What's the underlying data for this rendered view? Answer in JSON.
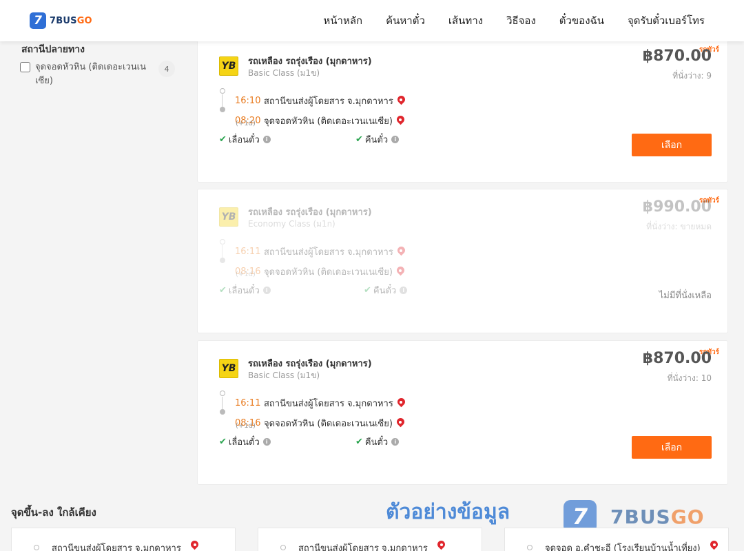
{
  "header": {
    "logo_text": "7BUS",
    "logo_text_go": "GO",
    "logo_mark": "7",
    "nav": [
      "หน้าหลัก",
      "ค้นหาตั๋ว",
      "เส้นทาง",
      "วิธีจอง",
      "ตั๋วของฉัน",
      "จุดรับตั๋วเบอร์โทร"
    ]
  },
  "filter": {
    "title": "สถานีปลายทาง",
    "items": [
      {
        "label": "จุดจอดหัวหิน (ติดเดอะเวนเนเซีย)",
        "count": "4"
      }
    ]
  },
  "trips": [
    {
      "tag": "รถทัวร์",
      "operator": "รถเหลือง รถรุ่งเรือง (มุกดาหาร)",
      "class": "Basic Class (ม1ข)",
      "price": "฿870.00",
      "seats": "ที่นั่งว่าง: 9",
      "depart_time": "16:10",
      "depart_place": "สถานีขนส่งผู้โดยสาร จ.มุกดาหาร",
      "arrive_time": "08:20",
      "arrive_place": "จุดจอดหัวหิน (ติดเดอะเวนเนเซีย)",
      "day_offset": "(+1d)",
      "feature1": "เลื่อนตั๋ว",
      "feature2": "คืนตั๋ว",
      "action": "เลือก"
    },
    {
      "tag": "รถทัวร์",
      "operator": "รถเหลือง รถรุ่งเรือง (มุกดาหาร)",
      "class": "Economy Class (ม1ก)",
      "price": "฿990.00",
      "seats": "ที่นั่งว่าง: ขายหมด",
      "depart_time": "16:11",
      "depart_place": "สถานีขนส่งผู้โดยสาร จ.มุกดาหาร",
      "arrive_time": "08:16",
      "arrive_place": "จุดจอดหัวหิน (ติดเดอะเวนเนเซีย)",
      "day_offset": "(+1d)",
      "feature1": "เลื่อนตั๋ว",
      "feature2": "คืนตั๋ว",
      "note": "ไม่มีที่นั่งเหลือ"
    },
    {
      "tag": "รถทัวร์",
      "operator": "รถเหลือง รถรุ่งเรือง (มุกดาหาร)",
      "class": "Basic Class (ม1ข)",
      "price": "฿870.00",
      "seats": "ที่นั่งว่าง: 10",
      "depart_time": "16:11",
      "depart_place": "สถานีขนส่งผู้โดยสาร จ.มุกดาหาร",
      "arrive_time": "08:16",
      "arrive_place": "จุดจอดหัวหิน (ติดเดอะเวนเนเซีย)",
      "day_offset": "(+1d)",
      "feature1": "เลื่อนตั๋ว",
      "feature2": "คืนตั๋ว",
      "action": "เลือก"
    }
  ],
  "nearby": {
    "title": "จุดขึ้น-ลง ใกล้เคียง",
    "items": [
      "สถานีขนส่งผู้โดยสาร จ.มุกดาหาร",
      "สถานีขนส่งผู้โดยสาร จ.มุกดาหาร",
      "จุดจอด อ.คำชะอี (โรงเรียนบ้านน้ำเที่ยง)"
    ]
  },
  "watermark": {
    "text": "ตัวอย่างข้อมูล",
    "logo_mark": "7",
    "logo_text": "7BUS",
    "logo_text_go": "GO"
  },
  "colors": {
    "accent": "#ff6a13",
    "brand_blue": "#2f6fd6",
    "pin_red": "#e0262d",
    "check_green": "#2aa44f"
  },
  "icons": {
    "pin": "map-pin-icon",
    "check": "check-icon",
    "info": "info-icon"
  }
}
